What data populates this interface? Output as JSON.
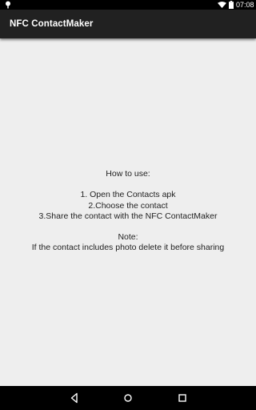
{
  "status_bar": {
    "time": "07:08",
    "icons": [
      "location-pin-icon",
      "wifi-icon",
      "battery-icon"
    ]
  },
  "app_bar": {
    "title": "NFC ContactMaker"
  },
  "instructions": {
    "heading": "How to use:",
    "steps": [
      "1. Open the Contacts apk",
      "2.Choose the contact",
      "3.Share the contact with the NFC ContactMaker"
    ],
    "note_heading": "Note:",
    "note_text": "If the contact includes photo delete it before sharing"
  },
  "nav_bar": {
    "icons": [
      "back-icon",
      "home-icon",
      "recents-icon"
    ]
  },
  "colors": {
    "status_bar": "#000000",
    "app_bar": "#212121",
    "background": "#eeeeee",
    "text": "#222222",
    "nav_bar": "#000000"
  }
}
